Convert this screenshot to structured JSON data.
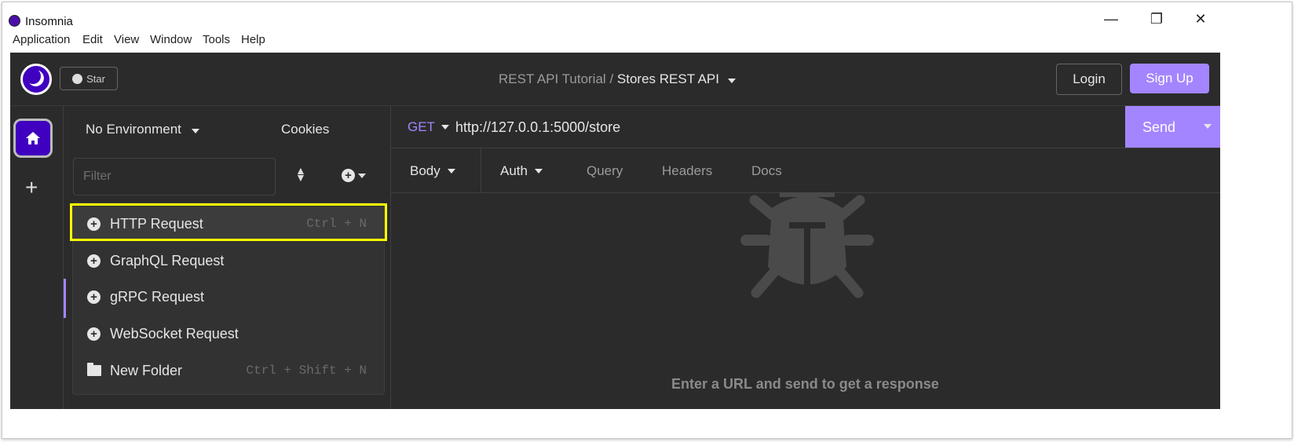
{
  "window": {
    "title": "Insomnia",
    "controls": {
      "minimize": "—",
      "restore": "❐",
      "close": "✕"
    }
  },
  "menubar": [
    "Application",
    "Edit",
    "View",
    "Window",
    "Tools",
    "Help"
  ],
  "header": {
    "star_label": "Star",
    "breadcrumb_project": "REST API Tutorial",
    "breadcrumb_sep": "/",
    "breadcrumb_current": "Stores REST API",
    "login_label": "Login",
    "signup_label": "Sign Up"
  },
  "sidebar": {
    "environment": "No Environment",
    "cookies": "Cookies",
    "filter_placeholder": "Filter",
    "new_menu": [
      {
        "label": "HTTP Request",
        "shortcut": "Ctrl + N",
        "icon": "plus-circle-icon"
      },
      {
        "label": "GraphQL Request",
        "shortcut": "",
        "icon": "plus-circle-icon"
      },
      {
        "label": "gRPC Request",
        "shortcut": "",
        "icon": "plus-circle-icon"
      },
      {
        "label": "WebSocket Request",
        "shortcut": "",
        "icon": "plus-circle-icon"
      },
      {
        "label": "New Folder",
        "shortcut": "Ctrl + Shift + N",
        "icon": "folder-icon"
      }
    ]
  },
  "request": {
    "method": "GET",
    "url": "http://127.0.0.1:5000/store",
    "send_label": "Send",
    "tabs": [
      "Body",
      "Auth",
      "Query",
      "Headers",
      "Docs"
    ]
  },
  "response": {
    "empty_message": "Enter a URL and send to get a response"
  },
  "colors": {
    "accent": "#a385ff",
    "brand": "#4000bf",
    "background": "#2b2b2b",
    "highlight": "#ffff00"
  }
}
